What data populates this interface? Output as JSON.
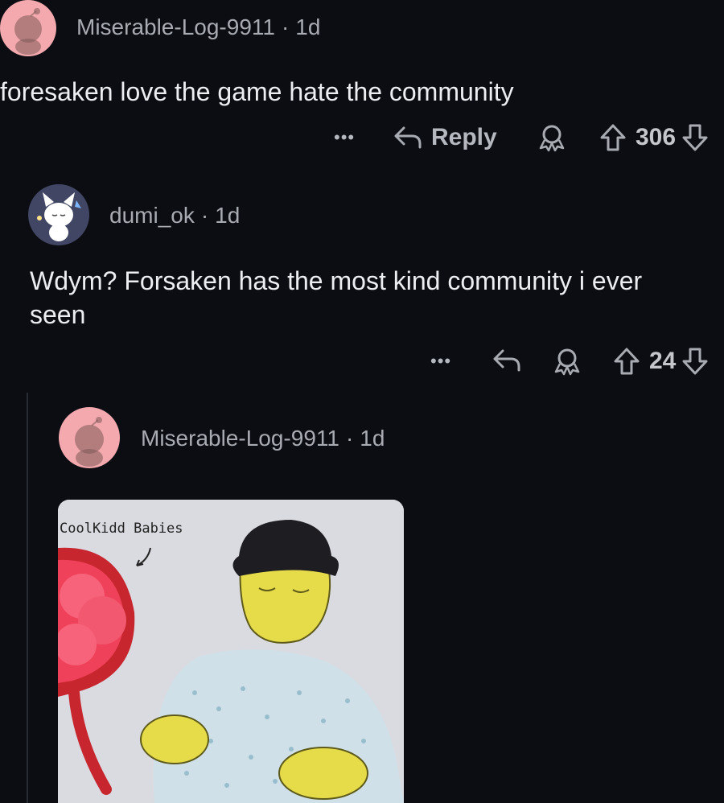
{
  "comments": [
    {
      "username": "Miserable-Log-9911",
      "age": "1d",
      "text": "foresaken love the game hate the community",
      "actions": {
        "more": "•••",
        "reply_label": "Reply",
        "score": "306"
      }
    },
    {
      "username": "dumi_ok",
      "age": "1d",
      "text_line1": "Wdym? Forsaken has the most kind community i ever",
      "text_line2": "seen",
      "actions": {
        "more": "•••",
        "score": "24"
      }
    },
    {
      "username": "Miserable-Log-9911",
      "age": "1d",
      "image": {
        "handwritten_label": "CoolKidd Babies"
      }
    }
  ],
  "colors": {
    "background": "#0c0d12",
    "avatar_pink": "#f4a9ae",
    "text_primary": "#eceef2",
    "text_secondary": "#a9abb3"
  },
  "icons": [
    "snoo-avatar",
    "reply-arrow-icon",
    "award-icon",
    "upvote-icon",
    "downvote-icon",
    "more-icon",
    "cat-avatar"
  ]
}
